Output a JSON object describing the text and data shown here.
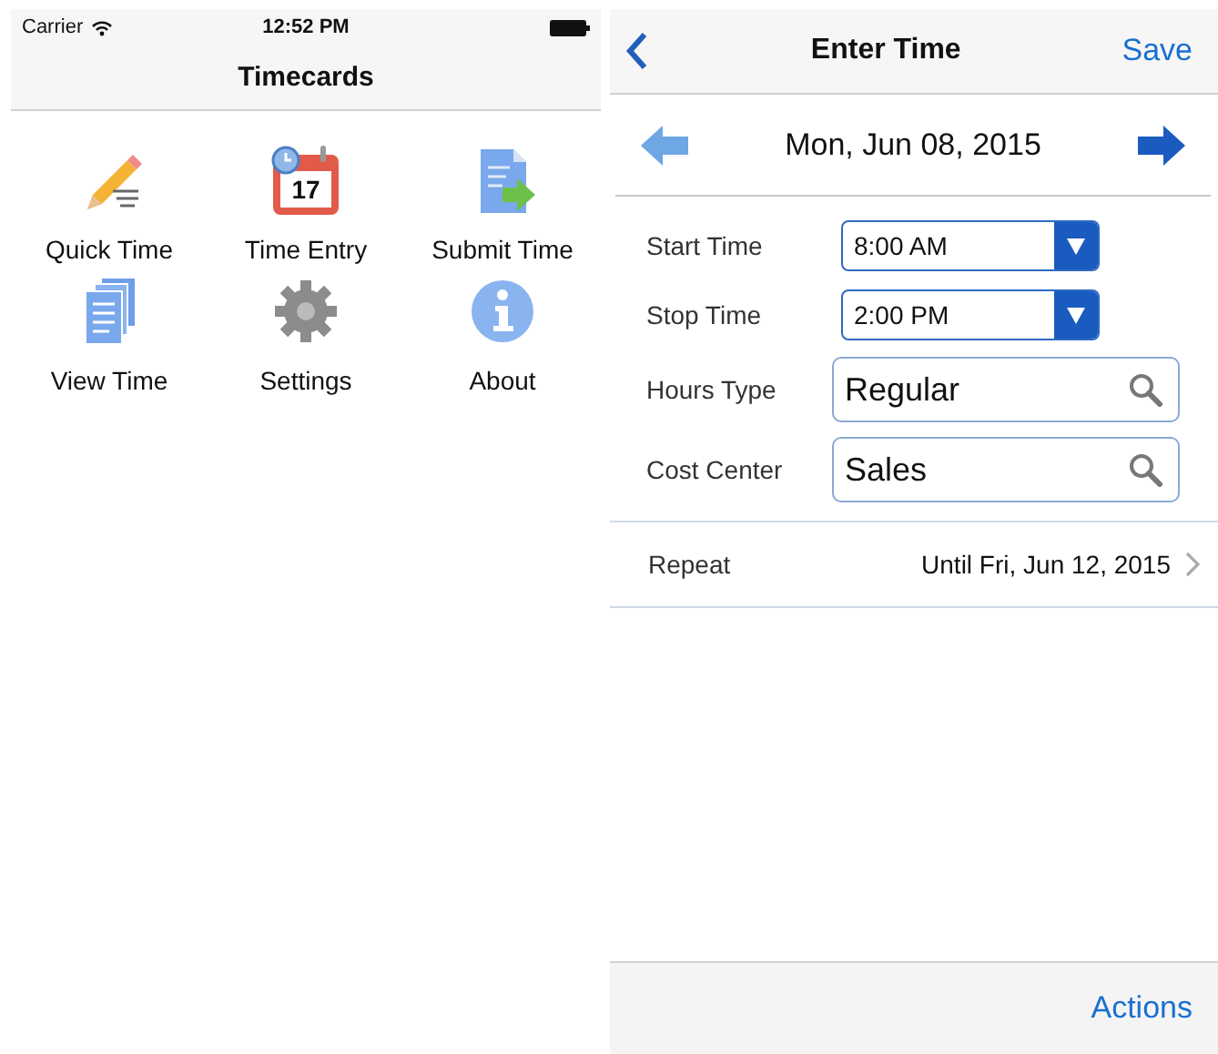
{
  "home": {
    "status_bar": {
      "carrier": "Carrier",
      "time": "12:52 PM"
    },
    "title": "Timecards",
    "menu": [
      {
        "label": "Quick Time",
        "kind": "pencil"
      },
      {
        "label": "Time Entry",
        "kind": "calendar",
        "icon_text": "17"
      },
      {
        "label": "Submit Time",
        "kind": "submit"
      },
      {
        "label": "View Time",
        "kind": "pages"
      },
      {
        "label": "Settings",
        "kind": "gear"
      },
      {
        "label": "About",
        "kind": "info"
      }
    ]
  },
  "entry": {
    "title": "Enter Time",
    "save": "Save",
    "date": "Mon, Jun 08, 2015",
    "fields": [
      {
        "label": "Start Time",
        "kind": "select",
        "value": "8:00 AM"
      },
      {
        "label": "Stop Time",
        "kind": "select",
        "value": "2:00 PM"
      },
      {
        "label": "Hours Type",
        "kind": "search",
        "value": "Regular"
      },
      {
        "label": "Cost Center",
        "kind": "search",
        "value": "Sales"
      }
    ],
    "repeat": {
      "label": "Repeat",
      "value": "Until Fri, Jun 12, 2015"
    },
    "footer": {
      "action": "Actions"
    }
  }
}
